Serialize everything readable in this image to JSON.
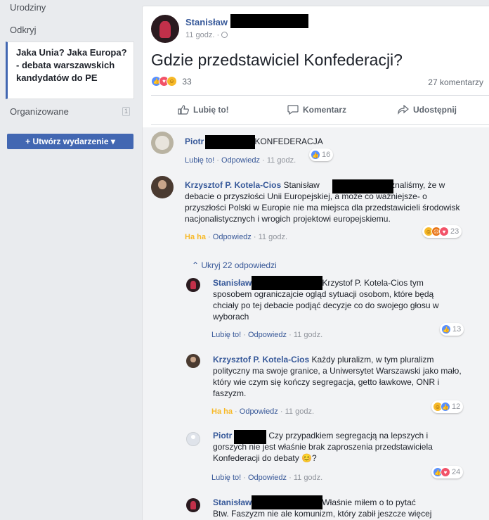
{
  "sidebar": {
    "items": [
      "Urodziny",
      "Odkryj"
    ],
    "active_event": "Jaka Unia? Jaka Europa?- debata warszawskich kandydatów do PE",
    "organized_label": "Organizowane",
    "organized_count": "1",
    "create_button": "+ Utwórz wydarzenie ▾"
  },
  "post": {
    "author": "Stanisław",
    "time": "11 godz. ·",
    "title": "Gdzie przedstawiciel Konfederacji?",
    "reaction_count": "33",
    "comments_count": "27 komentarzy",
    "actions": {
      "like": "Lubię to!",
      "comment": "Komentarz",
      "share": "Udostępnij"
    }
  },
  "comment_actions": {
    "like": "Lubię to!",
    "haha": "Ha ha",
    "reply": "Odpowiedz",
    "sep": "·",
    "time": "11 godz."
  },
  "comments": [
    {
      "name": "Piotr",
      "text": "KONFEDERACJA",
      "reactions": "16"
    },
    {
      "name": "Krzysztof P. Kotela-Cios",
      "text_before": "Stanisław",
      "text": ", uznaliśmy, że w debacie o przyszłości Unii Europejskiej, a może co ważniejsze- o przyszłości Polski w Europie nie ma miejsca dla przedstawicieli środowisk nacjonalistycznych i wrogich projektowi europejskiemu.",
      "reactions": "23"
    }
  ],
  "hide_replies": "⌃ Ukryj 22 odpowiedzi",
  "replies": [
    {
      "name": "Stanisław",
      "text": "Krzystof P. Kotela-Cios tym sposobem ograniczajcie ogląd sytuacji osobom, które będą chciały po tej debacie podjąć decyzje co do swojego głosu w wyborach",
      "reactions": "13"
    },
    {
      "name": "Krzysztof P. Kotela-Cios",
      "text": "Każdy pluralizm, w tym pluralizm polityczny ma swoje granice, a Uniwersytet Warszawski jako mało, który wie czym się kończy segregacja, getto ławkowe, ONR i faszyzm.",
      "reactions": "12"
    },
    {
      "name": "Piotr",
      "text": "Czy przypadkiem segregacją na lepszych i gorszych nie jest właśnie brak zaproszenia przedstawiciela Konfederacji do debaty",
      "emoji": "😊?",
      "reactions": "24"
    },
    {
      "name": "Stanisław",
      "text": "Właśnie miłem o to pytać",
      "text_line2": "Btw. Faszyzm nie ale komunizm, który zabił jeszcze więcej"
    }
  ],
  "colors": {
    "link": "#365899",
    "accent": "#4267b2",
    "muted": "#90949c",
    "haha": "#f7b928"
  }
}
